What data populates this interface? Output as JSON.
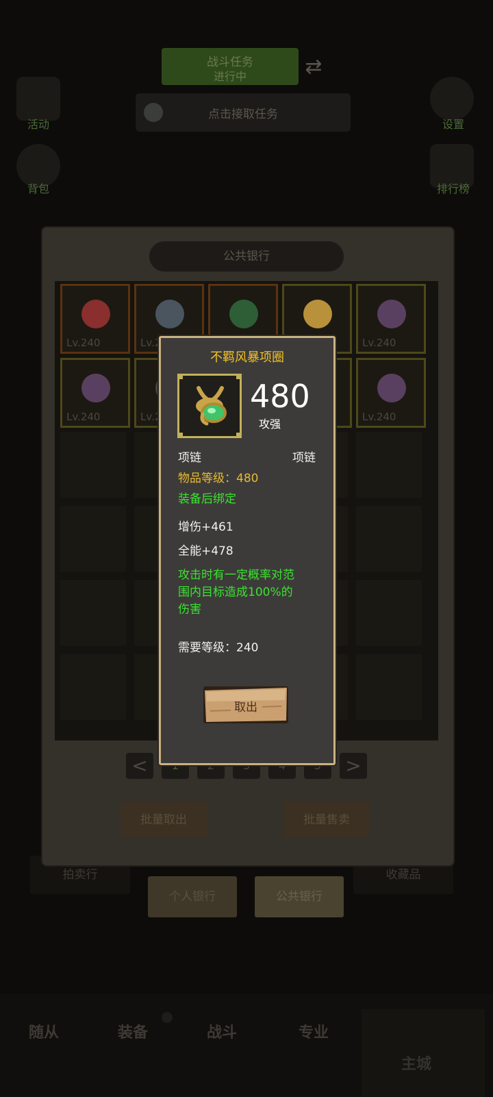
{
  "background": {
    "task_box": {
      "line1": "战斗任务",
      "line2": "进行中"
    },
    "get_task": "点击接取任务",
    "side_left": [
      "活动",
      "背包"
    ],
    "side_right": [
      "设置",
      "排行榜"
    ]
  },
  "bank": {
    "title": "公共银行",
    "items": [
      {
        "level": "Lv.240",
        "frame": "orange"
      },
      {
        "level": "Lv.240",
        "frame": "orange"
      },
      {
        "level": "",
        "frame": "orange"
      },
      {
        "level": "",
        "frame": "yellow"
      },
      {
        "level": "Lv.240",
        "frame": "yellow"
      },
      {
        "level": "Lv.240",
        "frame": "yellow"
      },
      {
        "level": "Lv.240",
        "frame": "yellow"
      },
      {
        "level": "",
        "frame": "yellow"
      },
      {
        "level": "",
        "frame": "yellow"
      },
      {
        "level": "Lv.240",
        "frame": "yellow"
      }
    ],
    "pager": {
      "prev": "<",
      "next": ">",
      "pages": [
        "1",
        "2",
        "3",
        "4",
        "5"
      ]
    },
    "batch_take": "批量取出",
    "batch_sell": "批量售卖"
  },
  "tabs_behind": [
    "拍卖行",
    "收藏品"
  ],
  "tabs": [
    "个人银行",
    "公共银行"
  ],
  "bottom_nav": [
    "随从",
    "装备",
    "战斗",
    "专业",
    "主城"
  ],
  "tooltip": {
    "name": "不羁风暴项圈",
    "score": "480",
    "score_label": "攻强",
    "slot_left": "项链",
    "slot_right": "项链",
    "item_level": "物品等级：480",
    "bind": "装备后绑定",
    "stat1": "增伤+461",
    "stat2": "全能+478",
    "effect_line1": "攻击时有一定概率对范",
    "effect_line2": "围内目标造成100%的",
    "effect_line3": "伤害",
    "required_level": "需要等级：240",
    "take_out": "取出"
  },
  "colors": {
    "title": "#f3c127",
    "item_level": "#e8b934",
    "green": "#3be331",
    "frame": "#c9b283"
  }
}
